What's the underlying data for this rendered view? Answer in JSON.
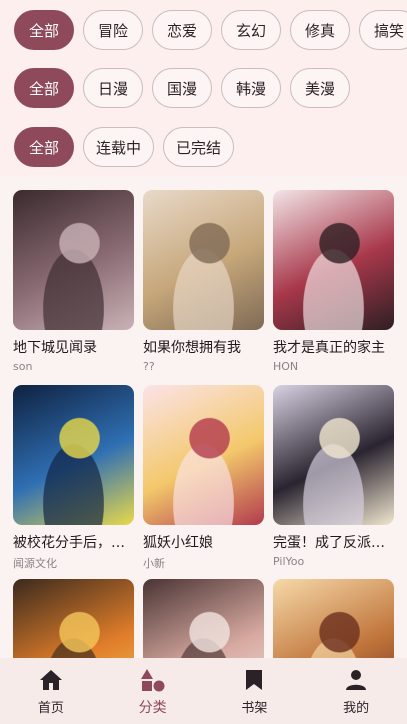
{
  "filters": {
    "genre": [
      {
        "label": "全部",
        "active": true
      },
      {
        "label": "冒险",
        "active": false
      },
      {
        "label": "恋爱",
        "active": false
      },
      {
        "label": "玄幻",
        "active": false
      },
      {
        "label": "修真",
        "active": false
      },
      {
        "label": "搞笑",
        "active": false
      }
    ],
    "region": [
      {
        "label": "全部",
        "active": true
      },
      {
        "label": "日漫",
        "active": false
      },
      {
        "label": "国漫",
        "active": false
      },
      {
        "label": "韩漫",
        "active": false
      },
      {
        "label": "美漫",
        "active": false
      }
    ],
    "status": [
      {
        "label": "全部",
        "active": true
      },
      {
        "label": "连载中",
        "active": false
      },
      {
        "label": "已完结",
        "active": false
      }
    ]
  },
  "comics": [
    {
      "title": "地下城见闻录",
      "author": "son",
      "palette": [
        "#3a2a2e",
        "#8a6b73",
        "#c9b2b6"
      ]
    },
    {
      "title": "如果你想拥有我",
      "author": "??",
      "palette": [
        "#e9d9c9",
        "#c6a77a",
        "#7f6a55"
      ]
    },
    {
      "title": "我才是真正的家主",
      "author": "HON",
      "palette": [
        "#f2e5e6",
        "#a8384b",
        "#2e1f23"
      ]
    },
    {
      "title": "被校花分手后，…",
      "author": "闻源文化",
      "palette": [
        "#0f2140",
        "#2f6fb3",
        "#e9d94a"
      ]
    },
    {
      "title": "狐妖小红娘",
      "author": "小新",
      "palette": [
        "#fbe3e8",
        "#f3c86b",
        "#b23a4d"
      ]
    },
    {
      "title": "完蛋！成了反派…",
      "author": "PilYoo",
      "palette": [
        "#d9d2e3",
        "#2a2430",
        "#f1e6cf"
      ]
    },
    {
      "title": "",
      "author": "",
      "palette": [
        "#3b2a1d",
        "#e07d2a",
        "#f5c75a"
      ]
    },
    {
      "title": "",
      "author": "",
      "palette": [
        "#4a3434",
        "#d7a9a0",
        "#f2e4e0"
      ]
    },
    {
      "title": "",
      "author": "",
      "palette": [
        "#f6d9a8",
        "#c0743b",
        "#6b2f1c"
      ]
    }
  ],
  "nav": [
    {
      "label": "首页",
      "icon": "home-icon",
      "active": false
    },
    {
      "label": "分类",
      "icon": "category-icon",
      "active": true
    },
    {
      "label": "书架",
      "icon": "bookmark-icon",
      "active": false
    },
    {
      "label": "我的",
      "icon": "person-icon",
      "active": false
    }
  ]
}
